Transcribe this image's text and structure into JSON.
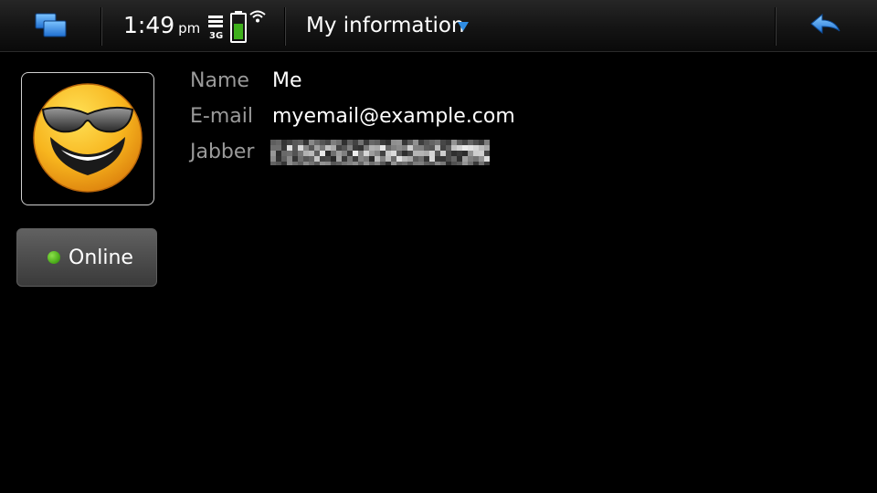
{
  "statusbar": {
    "time": "1:49",
    "ampm": "pm",
    "network": "3G",
    "battery_icon": "battery-icon",
    "wifi_icon": "wifi-icon",
    "switcher_icon": "task-switcher-icon",
    "back_icon": "back-arrow-icon"
  },
  "title": {
    "text": "My information",
    "menu_icon": "dropdown-caret-icon"
  },
  "profile": {
    "avatar_icon": "sunglasses-smiley-icon",
    "presence": {
      "label": "Online",
      "status_color": "#4eae1c"
    },
    "fields": [
      {
        "label": "Name",
        "value": "Me"
      },
      {
        "label": "E-mail",
        "value": "myemail@example.com"
      },
      {
        "label": "Jabber",
        "value": "",
        "obscured": true
      }
    ]
  },
  "colors": {
    "accent": "#2f8de4",
    "background": "#000000",
    "label": "#9a9a9a",
    "text": "#ffffff"
  }
}
